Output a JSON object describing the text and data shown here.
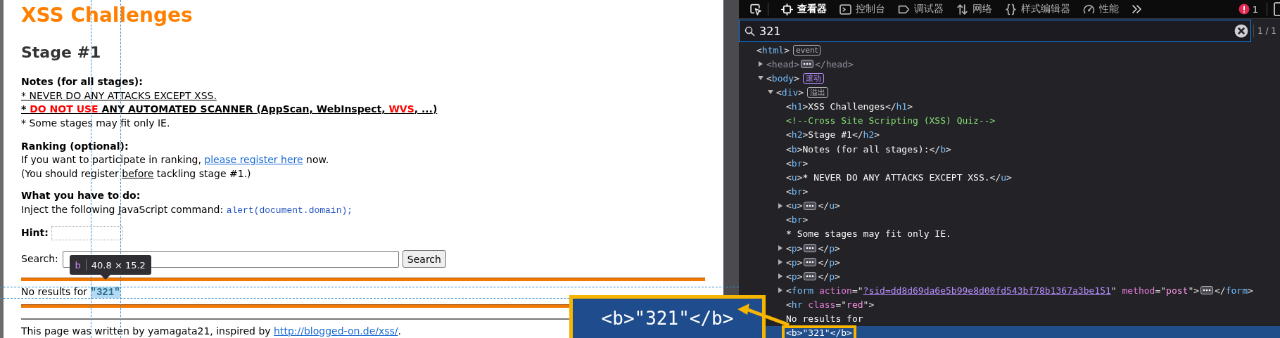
{
  "page": {
    "title": "XSS Challenges",
    "stage": "Stage #1",
    "notes_heading": "Notes (for all stages):",
    "notes": [
      {
        "kind": "underlined",
        "segments": [
          {
            "text": "* NEVER DO ANY ATTACKS EXCEPT XSS.",
            "red": false
          }
        ]
      },
      {
        "kind": "bold_underlined",
        "segments": [
          {
            "text": "* ",
            "red": false
          },
          {
            "text": "DO NOT USE",
            "red": true
          },
          {
            "text": " ANY AUTOMATED SCANNER (AppScan, WebInspect, ",
            "red": false
          },
          {
            "text": "WVS",
            "red": true
          },
          {
            "text": ", ...)",
            "red": false
          }
        ]
      },
      {
        "kind": "plain",
        "segments": [
          {
            "text": "* Some stages may fit only IE.",
            "red": false
          }
        ]
      }
    ],
    "ranking_heading": "Ranking (optional):",
    "ranking_text": {
      "before": "If you want to participate in ranking, ",
      "link": "please register here",
      "after": " now."
    },
    "register_note": {
      "before": "(You should register ",
      "underlined": "before",
      "after": " tackling stage #1.)"
    },
    "task_heading": "What you have to do:",
    "task_text": "Inject the following JavaScript command: ",
    "task_code": "alert(document.domain);",
    "hint_label": "Hint:",
    "search_label": "Search:",
    "search_button": "Search",
    "result_text": "No results for ",
    "result_query": "\"321\"",
    "footer": {
      "before": "This page was written by yamagata21, inspired by ",
      "link": "http://blogged-on.de/xss/",
      "after": "."
    }
  },
  "inspector_tooltip": {
    "tag": "b",
    "size": "40.8 × 15.2"
  },
  "devtools": {
    "tabs": [
      {
        "kind": "inspector",
        "label": "查看器",
        "selected": true
      },
      {
        "kind": "console",
        "label": "控制台",
        "selected": false
      },
      {
        "kind": "debugger",
        "label": "调试器",
        "selected": false
      },
      {
        "kind": "network",
        "label": "网络",
        "selected": false
      },
      {
        "kind": "style_editor",
        "label": "样式编辑器",
        "selected": false
      },
      {
        "kind": "performance",
        "label": "性能",
        "selected": false
      }
    ],
    "error_count": "1",
    "search": {
      "value": "321",
      "match_count": "1 / 1"
    },
    "tree": [
      {
        "selected": false,
        "dimmed": false,
        "parts": [
          {
            "kind": "punct",
            "text": "<"
          },
          {
            "kind": "tag",
            "text": "html"
          },
          {
            "kind": "punct",
            "text": ">"
          },
          {
            "kind": "badge",
            "text": "event",
            "color": "#b1b1b3"
          }
        ],
        "children": [
          {
            "expanded": false,
            "selected": false,
            "dimmed": true,
            "parts": [
              {
                "kind": "punct",
                "text": "<"
              },
              {
                "kind": "tag",
                "text": "head"
              },
              {
                "kind": "punct",
                "text": ">"
              },
              {
                "kind": "ellipsis"
              },
              {
                "kind": "punct",
                "text": "</"
              },
              {
                "kind": "tag",
                "text": "head"
              },
              {
                "kind": "punct",
                "text": ">"
              }
            ]
          },
          {
            "expanded": true,
            "selected": false,
            "dimmed": false,
            "parts": [
              {
                "kind": "punct",
                "text": "<"
              },
              {
                "kind": "tag",
                "text": "body"
              },
              {
                "kind": "punct",
                "text": ">"
              },
              {
                "kind": "badge",
                "text": "滚动",
                "color": "#b98eff"
              }
            ],
            "children": [
              {
                "expanded": true,
                "selected": false,
                "dimmed": false,
                "parts": [
                  {
                    "kind": "punct",
                    "text": "<"
                  },
                  {
                    "kind": "tag",
                    "text": "div"
                  },
                  {
                    "kind": "punct",
                    "text": ">"
                  },
                  {
                    "kind": "badge",
                    "text": "溢出",
                    "color": "#b1b1b3"
                  }
                ],
                "children": [
                  {
                    "selected": false,
                    "dimmed": false,
                    "parts": [
                      {
                        "kind": "punct",
                        "text": "<"
                      },
                      {
                        "kind": "tag",
                        "text": "h1"
                      },
                      {
                        "kind": "punct",
                        "text": ">"
                      },
                      {
                        "kind": "text",
                        "text": "XSS Challenges"
                      },
                      {
                        "kind": "punct",
                        "text": "</"
                      },
                      {
                        "kind": "tag",
                        "text": "h1"
                      },
                      {
                        "kind": "punct",
                        "text": ">"
                      }
                    ]
                  },
                  {
                    "selected": false,
                    "dimmed": false,
                    "parts": [
                      {
                        "kind": "comment",
                        "text": "<!--Cross Site Scripting (XSS) Quiz-->"
                      }
                    ]
                  },
                  {
                    "selected": false,
                    "dimmed": false,
                    "parts": [
                      {
                        "kind": "punct",
                        "text": "<"
                      },
                      {
                        "kind": "tag",
                        "text": "h2"
                      },
                      {
                        "kind": "punct",
                        "text": ">"
                      },
                      {
                        "kind": "text",
                        "text": "Stage #1"
                      },
                      {
                        "kind": "punct",
                        "text": "</"
                      },
                      {
                        "kind": "tag",
                        "text": "h2"
                      },
                      {
                        "kind": "punct",
                        "text": ">"
                      }
                    ]
                  },
                  {
                    "selected": false,
                    "dimmed": false,
                    "parts": [
                      {
                        "kind": "punct",
                        "text": "<"
                      },
                      {
                        "kind": "tag",
                        "text": "b"
                      },
                      {
                        "kind": "punct",
                        "text": ">"
                      },
                      {
                        "kind": "text",
                        "text": "Notes (for all stages):"
                      },
                      {
                        "kind": "punct",
                        "text": "</"
                      },
                      {
                        "kind": "tag",
                        "text": "b"
                      },
                      {
                        "kind": "punct",
                        "text": ">"
                      }
                    ]
                  },
                  {
                    "selected": false,
                    "dimmed": false,
                    "parts": [
                      {
                        "kind": "punct",
                        "text": "<"
                      },
                      {
                        "kind": "tag",
                        "text": "br"
                      },
                      {
                        "kind": "punct",
                        "text": ">"
                      }
                    ]
                  },
                  {
                    "selected": false,
                    "dimmed": false,
                    "parts": [
                      {
                        "kind": "punct",
                        "text": "<"
                      },
                      {
                        "kind": "tag",
                        "text": "u"
                      },
                      {
                        "kind": "punct",
                        "text": ">"
                      },
                      {
                        "kind": "text",
                        "text": "* NEVER DO ANY ATTACKS EXCEPT XSS."
                      },
                      {
                        "kind": "punct",
                        "text": "</"
                      },
                      {
                        "kind": "tag",
                        "text": "u"
                      },
                      {
                        "kind": "punct",
                        "text": ">"
                      }
                    ]
                  },
                  {
                    "selected": false,
                    "dimmed": false,
                    "parts": [
                      {
                        "kind": "punct",
                        "text": "<"
                      },
                      {
                        "kind": "tag",
                        "text": "br"
                      },
                      {
                        "kind": "punct",
                        "text": ">"
                      }
                    ]
                  },
                  {
                    "expanded": false,
                    "selected": false,
                    "dimmed": false,
                    "parts": [
                      {
                        "kind": "punct",
                        "text": "<"
                      },
                      {
                        "kind": "tag",
                        "text": "u"
                      },
                      {
                        "kind": "punct",
                        "text": ">"
                      },
                      {
                        "kind": "ellipsis"
                      },
                      {
                        "kind": "punct",
                        "text": "</"
                      },
                      {
                        "kind": "tag",
                        "text": "u"
                      },
                      {
                        "kind": "punct",
                        "text": ">"
                      }
                    ]
                  },
                  {
                    "selected": false,
                    "dimmed": false,
                    "parts": [
                      {
                        "kind": "punct",
                        "text": "<"
                      },
                      {
                        "kind": "tag",
                        "text": "br"
                      },
                      {
                        "kind": "punct",
                        "text": ">"
                      }
                    ]
                  },
                  {
                    "selected": false,
                    "dimmed": false,
                    "parts": [
                      {
                        "kind": "text",
                        "text": "* Some stages may fit only IE."
                      }
                    ]
                  },
                  {
                    "expanded": false,
                    "selected": false,
                    "dimmed": false,
                    "parts": [
                      {
                        "kind": "punct",
                        "text": "<"
                      },
                      {
                        "kind": "tag",
                        "text": "p"
                      },
                      {
                        "kind": "punct",
                        "text": ">"
                      },
                      {
                        "kind": "ellipsis"
                      },
                      {
                        "kind": "punct",
                        "text": "</"
                      },
                      {
                        "kind": "tag",
                        "text": "p"
                      },
                      {
                        "kind": "punct",
                        "text": ">"
                      }
                    ]
                  },
                  {
                    "expanded": false,
                    "selected": false,
                    "dimmed": false,
                    "parts": [
                      {
                        "kind": "punct",
                        "text": "<"
                      },
                      {
                        "kind": "tag",
                        "text": "p"
                      },
                      {
                        "kind": "punct",
                        "text": ">"
                      },
                      {
                        "kind": "ellipsis"
                      },
                      {
                        "kind": "punct",
                        "text": "</"
                      },
                      {
                        "kind": "tag",
                        "text": "p"
                      },
                      {
                        "kind": "punct",
                        "text": ">"
                      }
                    ]
                  },
                  {
                    "expanded": false,
                    "selected": false,
                    "dimmed": false,
                    "parts": [
                      {
                        "kind": "punct",
                        "text": "<"
                      },
                      {
                        "kind": "tag",
                        "text": "p"
                      },
                      {
                        "kind": "punct",
                        "text": ">"
                      },
                      {
                        "kind": "ellipsis"
                      },
                      {
                        "kind": "punct",
                        "text": "</"
                      },
                      {
                        "kind": "tag",
                        "text": "p"
                      },
                      {
                        "kind": "punct",
                        "text": ">"
                      }
                    ]
                  },
                  {
                    "expanded": false,
                    "selected": false,
                    "dimmed": false,
                    "parts": [
                      {
                        "kind": "punct",
                        "text": "<"
                      },
                      {
                        "kind": "tag",
                        "text": "form"
                      },
                      {
                        "kind": "attr",
                        "text": " action"
                      },
                      {
                        "kind": "punct",
                        "text": "=\""
                      },
                      {
                        "kind": "link",
                        "text": "?sid=dd8d69da6e5b99e8d00fd543bf78b1367a3be151"
                      },
                      {
                        "kind": "punct",
                        "text": "\""
                      },
                      {
                        "kind": "attr",
                        "text": " method"
                      },
                      {
                        "kind": "punct",
                        "text": "=\""
                      },
                      {
                        "kind": "value",
                        "text": "post"
                      },
                      {
                        "kind": "punct",
                        "text": "\">"
                      },
                      {
                        "kind": "ellipsis"
                      },
                      {
                        "kind": "punct",
                        "text": "</"
                      },
                      {
                        "kind": "tag",
                        "text": "form"
                      },
                      {
                        "kind": "punct",
                        "text": ">"
                      }
                    ]
                  },
                  {
                    "selected": false,
                    "dimmed": false,
                    "parts": [
                      {
                        "kind": "punct",
                        "text": "<"
                      },
                      {
                        "kind": "tag",
                        "text": "hr"
                      },
                      {
                        "kind": "attr",
                        "text": " class"
                      },
                      {
                        "kind": "punct",
                        "text": "=\""
                      },
                      {
                        "kind": "value",
                        "text": "red"
                      },
                      {
                        "kind": "punct",
                        "text": "\">"
                      }
                    ]
                  },
                  {
                    "selected": false,
                    "dimmed": false,
                    "parts": [
                      {
                        "kind": "text",
                        "text": "No results for"
                      }
                    ]
                  },
                  {
                    "selected": true,
                    "dimmed": false,
                    "parts": [
                      {
                        "kind": "punct",
                        "text": "<"
                      },
                      {
                        "kind": "tag",
                        "text": "b"
                      },
                      {
                        "kind": "punct",
                        "text": ">"
                      },
                      {
                        "kind": "text",
                        "text": "\"321\""
                      },
                      {
                        "kind": "punct",
                        "text": "</"
                      },
                      {
                        "kind": "tag",
                        "text": "b"
                      },
                      {
                        "kind": "punct",
                        "text": ">"
                      }
                    ]
                  }
                ]
              }
            ]
          }
        ]
      }
    ]
  },
  "callout": {
    "text": "<b>\"321\"</b>"
  }
}
